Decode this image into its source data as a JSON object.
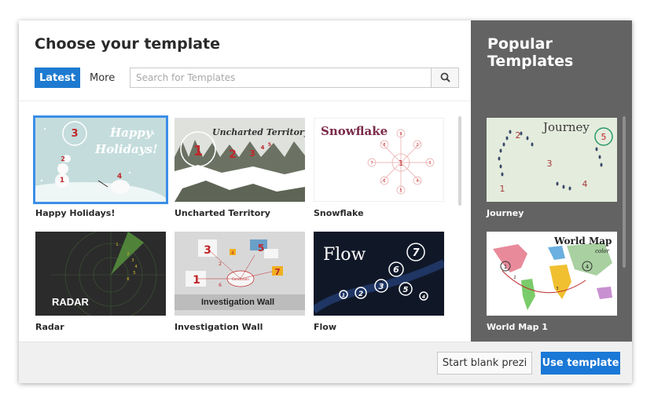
{
  "header": {
    "title": "Choose your template"
  },
  "tabs": {
    "latest": "Latest",
    "more": "More"
  },
  "search": {
    "placeholder": "Search for Templates",
    "icon": "search-icon"
  },
  "templates": [
    {
      "label": "Happy Holidays!",
      "thumb_text": "Happy Holidays!",
      "numbers": [
        "3",
        "2",
        "1",
        "4"
      ],
      "selected": true
    },
    {
      "label": "Uncharted Territory",
      "thumb_text": "Uncharted Territory",
      "numbers": [
        "1",
        "2",
        "3",
        "4",
        "5"
      ]
    },
    {
      "label": "Snowflake",
      "thumb_text": "Snowflake",
      "numbers": [
        "1",
        "2",
        "3",
        "4",
        "5",
        "6",
        "7",
        "8",
        "9"
      ]
    },
    {
      "label": "Radar",
      "thumb_text": "RADAR",
      "numbers": [
        "1",
        "2",
        "3",
        "4",
        "5",
        "6"
      ]
    },
    {
      "label": "Investigation Wall",
      "thumb_text": "Investigation Wall",
      "thumb_note": "Conclusion",
      "numbers": [
        "3",
        "5",
        "1",
        "7",
        "2",
        "4",
        "6"
      ]
    },
    {
      "label": "Flow",
      "thumb_text": "Flow",
      "numbers": [
        "7",
        "6",
        "5",
        "3",
        "2",
        "1",
        "4"
      ]
    }
  ],
  "popular": {
    "title": "Popular Templates",
    "items": [
      {
        "label": "Journey",
        "thumb_text": "Journey",
        "numbers": [
          "2",
          "5",
          "3",
          "1",
          "4"
        ]
      },
      {
        "label": "World Map 1",
        "thumb_text": "World Map",
        "thumb_subtext": "color",
        "numbers": [
          "1",
          "2",
          "3",
          "4"
        ]
      }
    ]
  },
  "footer": {
    "blank_label": "Start blank prezi",
    "use_label": "Use template"
  },
  "colors": {
    "accent": "#1e7ad0",
    "sidebar": "#636363",
    "footer": "#f0f0f0"
  }
}
